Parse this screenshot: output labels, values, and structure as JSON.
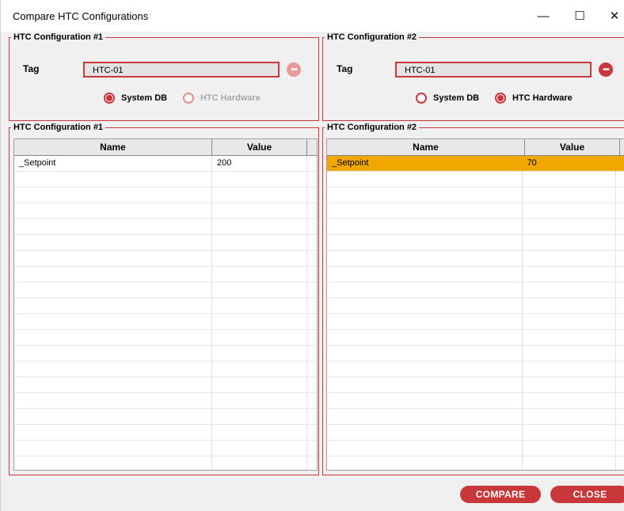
{
  "window": {
    "title": "Compare HTC Configurations",
    "minimize_glyph": "—",
    "maximize_glyph": "☐",
    "close_glyph": "✕"
  },
  "config1": {
    "legend": "HTC Configuration #1",
    "tag_label": "Tag",
    "tag_value": "HTC-01",
    "more_glyph": "•••",
    "radio_system_db": "System DB",
    "radio_htc_hardware": "HTC Hardware",
    "selected_source": "System DB"
  },
  "config2": {
    "legend": "HTC Configuration #2",
    "tag_label": "Tag",
    "tag_value": "HTC-01",
    "more_glyph": "•••",
    "radio_system_db": "System DB",
    "radio_htc_hardware": "HTC Hardware",
    "selected_source": "HTC Hardware"
  },
  "table1": {
    "legend": "HTC Configuration #1",
    "columns": [
      "Name",
      "Value"
    ],
    "rows": [
      {
        "name": "_Setpoint",
        "value": "200",
        "selected": false
      }
    ]
  },
  "table2": {
    "legend": "HTC Configuration #2",
    "columns": [
      "Name",
      "Value"
    ],
    "rows": [
      {
        "name": "_Setpoint",
        "value": "70",
        "selected": true
      }
    ]
  },
  "buttons": {
    "compare": "COMPARE",
    "close": "CLOSE"
  },
  "colors": {
    "accent": "#c8373a",
    "row_highlight": "#f0a800"
  }
}
